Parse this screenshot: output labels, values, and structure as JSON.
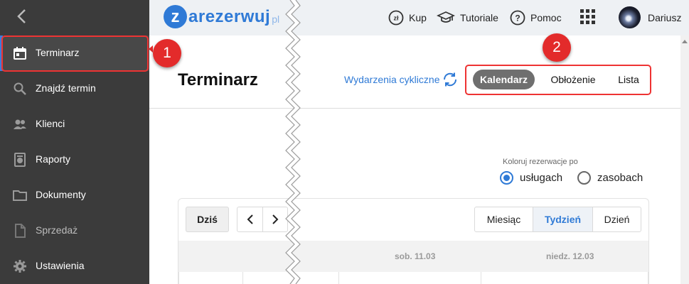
{
  "sidebar": {
    "items": [
      {
        "label": "Terminarz",
        "icon": "calendar-icon",
        "active": true
      },
      {
        "label": "Znajdź termin",
        "icon": "search-icon"
      },
      {
        "label": "Klienci",
        "icon": "people-icon"
      },
      {
        "label": "Raporty",
        "icon": "report-icon"
      },
      {
        "label": "Dokumenty",
        "icon": "folder-icon"
      },
      {
        "label": "Sprzedaż",
        "icon": "document-icon",
        "disabled": true
      },
      {
        "label": "Ustawienia",
        "icon": "gear-icon"
      }
    ]
  },
  "topbar": {
    "logo_letter": "z",
    "logo_text": "arezerwuj",
    "logo_suffix": "pl",
    "buy_label": "Kup",
    "buy_icon_text": "zł",
    "tutorials_label": "Tutoriale",
    "help_label": "Pomoc",
    "help_icon_text": "?",
    "user_name": "Dariusz"
  },
  "header": {
    "title": "Terminarz",
    "cyclic_label": "Wydarzenia cykliczne",
    "modes": [
      "Kalendarz",
      "Obłożenie",
      "Lista"
    ],
    "active_mode": "Kalendarz"
  },
  "color_by": {
    "label": "Koloruj rezerwacje po",
    "options": [
      "usługach",
      "zasobach"
    ],
    "selected": "usługach"
  },
  "calendar": {
    "today_label": "Dziś",
    "prev_label": "‹",
    "next_label": "›",
    "views": [
      "Miesiąc",
      "Tydzień",
      "Dzień"
    ],
    "active_view": "Tydzień",
    "days": [
      "sob. 11.03",
      "niedz. 12.03"
    ]
  },
  "annotations": {
    "badge1": "1",
    "badge2": "2"
  },
  "colors": {
    "accent": "#2f7ad6",
    "highlight": "#e33333",
    "sidebar": "#3b3b3b"
  }
}
